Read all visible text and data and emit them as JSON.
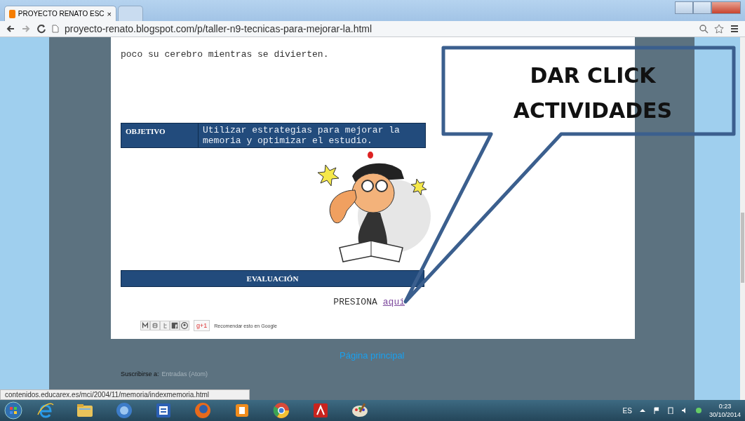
{
  "browser": {
    "tabs": [
      {
        "title": "PROYECTO RENATO ESC",
        "close": "×",
        "selected": true
      },
      {
        "selected": false
      }
    ],
    "url": "proyecto-renato.blogspot.com/p/taller-n9-tecnicas-para-mejorar-la.html"
  },
  "post": {
    "intro": "poco su cerebro mientras se divierten.",
    "objective": {
      "label": "OBJETIVO",
      "text": "Utilizar estrategias para mejorar la memoria y optimizar el estudio."
    },
    "evaluation_heading": "EVALUACIÓN",
    "press": {
      "text": "PRESIONA",
      "link": "aqui"
    },
    "share": {
      "gplus": "g+1",
      "recommend": "Recomendar esto en Google"
    }
  },
  "footer": {
    "home_link": "Página principal",
    "subscribe_label": "Suscribirse a:",
    "subscribe_link": "Entradas (Atom)"
  },
  "status_url": "contenidos.educarex.es/mci/2004/11/memoria/indexmemoria.html",
  "callout": {
    "text": "DAR CLICK ACTIVIDADES"
  },
  "taskbar": {
    "apps": [
      {
        "kind": "ie"
      },
      {
        "kind": "folder"
      },
      {
        "kind": "math"
      },
      {
        "kind": "word"
      },
      {
        "kind": "firefox"
      },
      {
        "kind": "media"
      },
      {
        "kind": "chrome"
      },
      {
        "kind": "pdf"
      },
      {
        "kind": "paint"
      }
    ],
    "language": "ES",
    "time": "0:23",
    "date": "30/10/2014"
  }
}
